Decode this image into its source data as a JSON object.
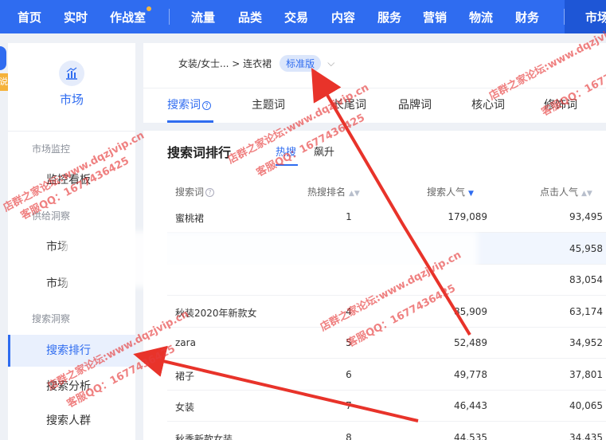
{
  "topnav": {
    "items": [
      "首页",
      "实时",
      "作战室",
      "流量",
      "品类",
      "交易",
      "内容",
      "服务",
      "营销",
      "物流",
      "财务"
    ],
    "active": "市场"
  },
  "sidebar": {
    "title": "市场",
    "badge": "说明",
    "groups": [
      {
        "label": "市场监控",
        "items": [
          "监控看板"
        ]
      },
      {
        "label": "供给洞察",
        "items": [
          "市场",
          "市场"
        ]
      },
      {
        "label": "搜索洞察",
        "items": [
          "搜索排行",
          "搜索分析",
          "搜索人群"
        ]
      }
    ],
    "active_item": "搜索排行"
  },
  "breadcrumb": {
    "path": "女装/女士... > 连衣裙",
    "tag": "标准版"
  },
  "tabs": [
    "搜索词",
    "主题词",
    "长尾词",
    "品牌词",
    "核心词",
    "修饰词"
  ],
  "active_tab": "搜索词",
  "ranking": {
    "title": "搜索词排行",
    "subtabs": [
      "热搜",
      "飙升"
    ],
    "active_subtab": "热搜",
    "columns": [
      "搜索词",
      "热搜排名",
      "搜索人气",
      "点击人气"
    ],
    "rows": [
      {
        "word": "蜜桃裙",
        "rank": "1",
        "search": "179,089",
        "click": "93,495"
      },
      {
        "word": "",
        "rank": "",
        "search": "",
        "click": "45,958"
      },
      {
        "word": "",
        "rank": "",
        "search": "",
        "click": "83,054"
      },
      {
        "word": "秋装2020年新款女",
        "rank": "4",
        "search": "85,909",
        "click": "63,174"
      },
      {
        "word": "zara",
        "rank": "5",
        "search": "52,489",
        "click": "34,952"
      },
      {
        "word": "裙子",
        "rank": "6",
        "search": "49,778",
        "click": "37,801"
      },
      {
        "word": "女装",
        "rank": "7",
        "search": "46,443",
        "click": "40,065"
      },
      {
        "word": "秋季新款女装",
        "rank": "8",
        "search": "44,535",
        "click": "34,435"
      }
    ]
  },
  "watermark": {
    "site": "店群之家论坛:www.dqzjvip.cn",
    "qq": "客服QQ：1677436425"
  },
  "colors": {
    "brand": "#2f6cf0",
    "arrow": "#e8332a",
    "badge": "#f5b23a"
  }
}
